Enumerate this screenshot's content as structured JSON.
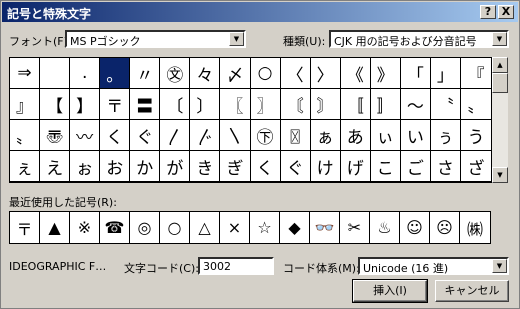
{
  "window": {
    "title": "記号と特殊文字",
    "help_label": "?",
    "close_label": "X"
  },
  "font": {
    "label": "フォント(F):",
    "value": "MS Pゴシック"
  },
  "category": {
    "label": "種類(U):",
    "value": "CJK 用の記号および分音記号"
  },
  "grid": {
    "selected_index": 3,
    "rows": [
      [
        "⇒",
        "",
        ".",
        "。",
        "〃",
        "㉆",
        "々",
        "〆",
        "○",
        "〈",
        "〉",
        "《",
        "》",
        "「",
        "」",
        "『"
      ],
      [
        "』",
        "【",
        "】",
        "〒",
        "〓",
        "〔",
        "〕",
        "〖",
        "〗",
        "〘",
        "〙",
        "〚",
        "〛",
        "〜",
        "〝",
        "〟"
      ],
      [
        "〟",
        "〠",
        "〰",
        "く",
        "ぐ",
        "〳",
        "〴",
        "〵",
        "㊦",
        "〿",
        "ぁ",
        "あ",
        "ぃ",
        "い",
        "ぅ",
        "う"
      ],
      [
        "ぇ",
        "え",
        "ぉ",
        "お",
        "か",
        "が",
        "き",
        "ぎ",
        "く",
        "ぐ",
        "け",
        "げ",
        "こ",
        "ご",
        "さ",
        "ざ"
      ]
    ]
  },
  "recent": {
    "label": "最近使用した記号(R):",
    "items": [
      "〒",
      "▲",
      "※",
      "☎",
      "◎",
      "○",
      "△",
      "×",
      "☆",
      "◆",
      "👓",
      "✂",
      "♨",
      "☺",
      "☹",
      "㈱"
    ]
  },
  "char_name": "IDEOGRAPHIC F…",
  "char_code": {
    "label": "文字コード(C):",
    "value": "3002"
  },
  "encoding": {
    "label": "コード体系(M):",
    "value": "Unicode (16 進)"
  },
  "buttons": {
    "insert": "挿入(I)",
    "cancel": "キャンセル"
  }
}
